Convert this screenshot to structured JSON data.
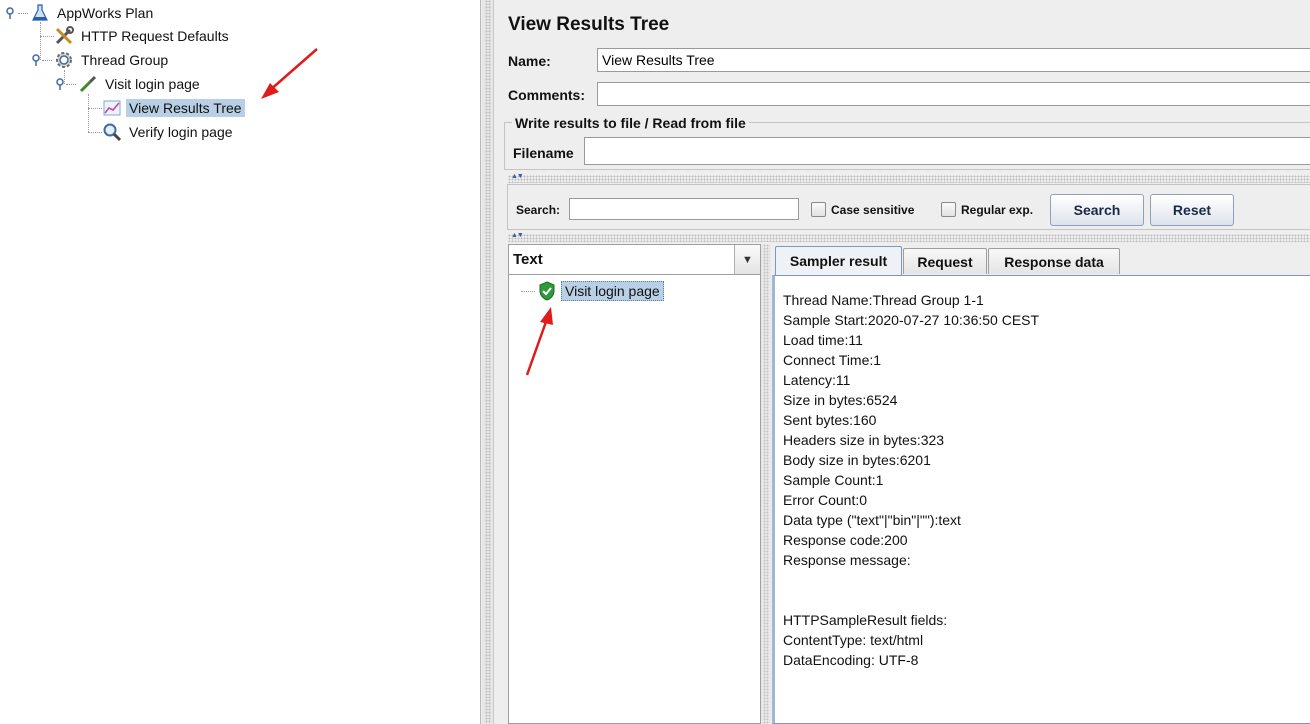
{
  "tree": {
    "items": [
      {
        "label": "AppWorks Plan"
      },
      {
        "label": "HTTP Request Defaults"
      },
      {
        "label": "Thread Group"
      },
      {
        "label": "Visit login page"
      },
      {
        "label": "View Results Tree"
      },
      {
        "label": "Verify login page"
      }
    ]
  },
  "panel": {
    "title": "View Results Tree",
    "name_label": "Name:",
    "name_value": "View Results Tree",
    "comments_label": "Comments:",
    "comments_value": "",
    "file_group_title": "Write results to file / Read from file",
    "filename_label": "Filename",
    "filename_value": ""
  },
  "search": {
    "label": "Search:",
    "value": "",
    "case_sensitive_label": "Case sensitive",
    "regex_label": "Regular exp.",
    "search_button": "Search",
    "reset_button": "Reset"
  },
  "results": {
    "renderer": "Text",
    "samples": [
      {
        "label": "Visit login page",
        "status": "success"
      }
    ]
  },
  "detail": {
    "tabs": [
      {
        "label": "Sampler result",
        "active": true
      },
      {
        "label": "Request",
        "active": false
      },
      {
        "label": "Response data",
        "active": false
      }
    ],
    "lines": [
      "Thread Name:Thread Group 1-1",
      "Sample Start:2020-07-27 10:36:50 CEST",
      "Load time:11",
      "Connect Time:1",
      "Latency:11",
      "Size in bytes:6524",
      "Sent bytes:160",
      "Headers size in bytes:323",
      "Body size in bytes:6201",
      "Sample Count:1",
      "Error Count:0",
      "Data type (\"text\"|\"bin\"|\"\"):text",
      "Response code:200",
      "Response message:",
      "",
      "",
      "HTTPSampleResult fields:",
      "ContentType: text/html",
      "DataEncoding: UTF-8"
    ]
  },
  "colors": {
    "selection": "#b8cfe5",
    "annotation_arrow": "#e01b1b",
    "success_shield": "#2e9a3a"
  }
}
